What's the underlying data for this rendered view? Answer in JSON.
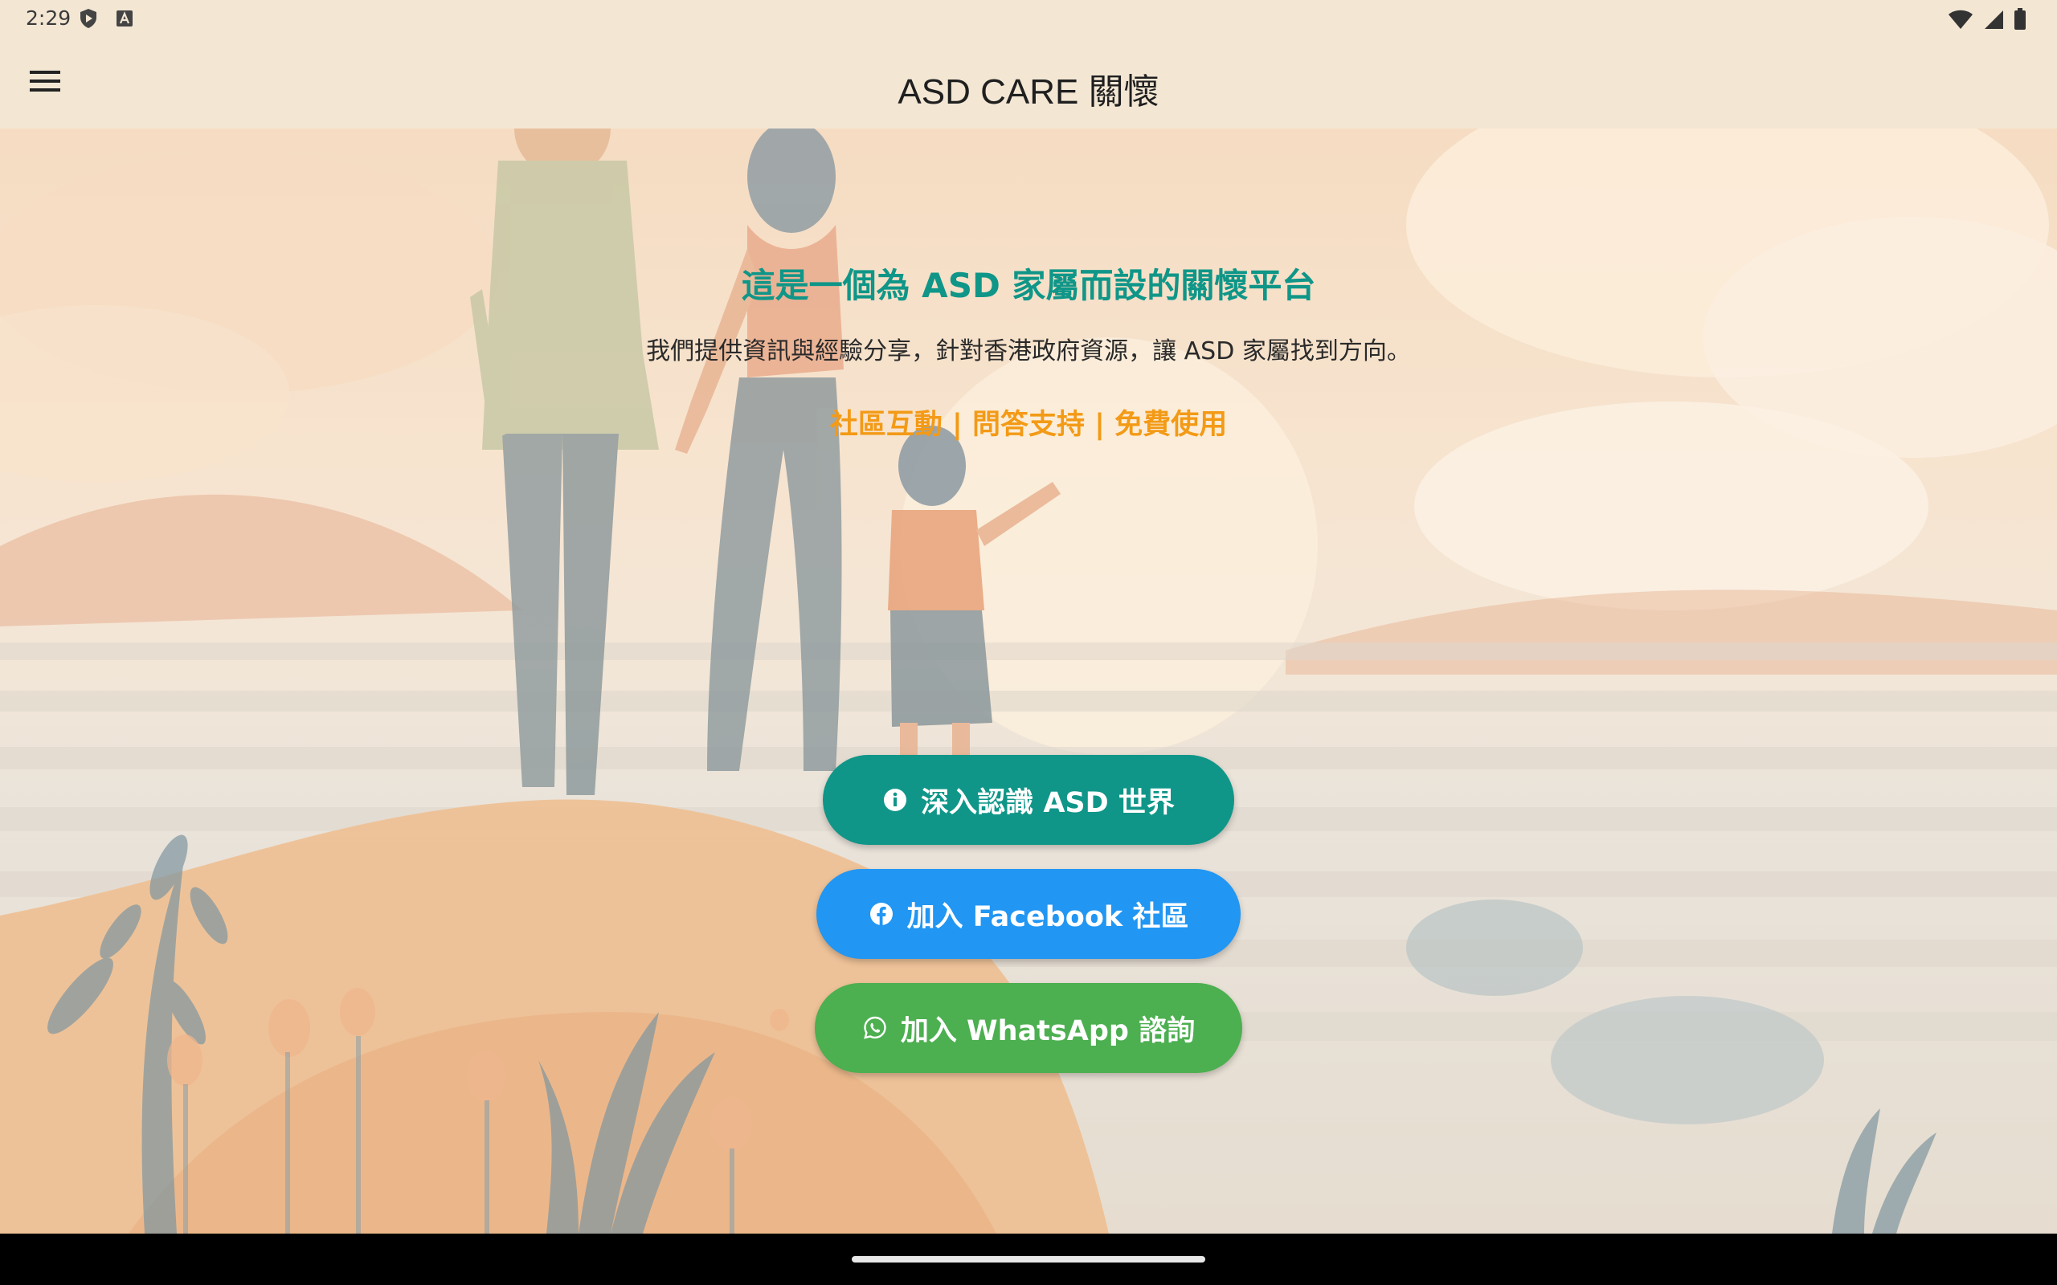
{
  "status_bar": {
    "time": "2:29",
    "left_icons": [
      "play-protect-icon",
      "a-badge-icon"
    ],
    "right_icons": [
      "wifi-icon",
      "signal-icon",
      "battery-icon"
    ]
  },
  "app_bar": {
    "title": "ASD CARE 關懷",
    "menu_icon": "menu-icon"
  },
  "hero": {
    "headline": "這是一個為 ASD 家屬而設的關懷平台",
    "description": "我們提供資訊與經驗分享，針對香港政府資源，讓 ASD 家屬找到方向。",
    "features": "社區互動 | 問答支持 | 免費使用"
  },
  "buttons": [
    {
      "label": "深入認識 ASD 世界",
      "icon": "info-icon",
      "color": "#0f9688"
    },
    {
      "label": "加入 Facebook 社區",
      "icon": "facebook-icon",
      "color": "#2196f3"
    },
    {
      "label": "加入 WhatsApp 諮詢",
      "icon": "whatsapp-icon",
      "color": "#4caf50"
    }
  ],
  "colors": {
    "app_bar": "#f3e7d4",
    "headline": "#0f9688",
    "features": "#f39a16"
  }
}
